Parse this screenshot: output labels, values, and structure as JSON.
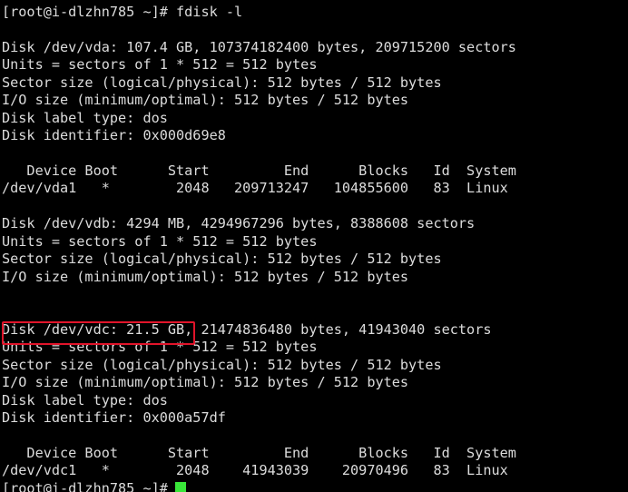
{
  "terminal": {
    "window_title": "root@i-dlzhn785:~",
    "background_color": "#000000",
    "foreground_color": "#dcdcdc",
    "cursor_color": "#39e639",
    "highlight_color": "#e1142a",
    "prompt": "[root@i-dlzhn785 ~]#",
    "command": "fdisk -l",
    "lines": [
      "[root@i-dlzhn785 ~]# fdisk -l",
      "",
      "Disk /dev/vda: 107.4 GB, 107374182400 bytes, 209715200 sectors",
      "Units = sectors of 1 * 512 = 512 bytes",
      "Sector size (logical/physical): 512 bytes / 512 bytes",
      "I/O size (minimum/optimal): 512 bytes / 512 bytes",
      "Disk label type: dos",
      "Disk identifier: 0x000d69e8",
      "",
      "   Device Boot      Start         End      Blocks   Id  System",
      "/dev/vda1   *        2048   209713247   104855600   83  Linux",
      "",
      "Disk /dev/vdb: 4294 MB, 4294967296 bytes, 8388608 sectors",
      "Units = sectors of 1 * 512 = 512 bytes",
      "Sector size (logical/physical): 512 bytes / 512 bytes",
      "I/O size (minimum/optimal): 512 bytes / 512 bytes",
      "",
      "",
      "Disk /dev/vdc: 21.5 GB, 21474836480 bytes, 41943040 sectors",
      "Units = sectors of 1 * 512 = 512 bytes",
      "Sector size (logical/physical): 512 bytes / 512 bytes",
      "I/O size (minimum/optimal): 512 bytes / 512 bytes",
      "Disk label type: dos",
      "Disk identifier: 0x000a57df",
      "",
      "   Device Boot      Start         End      Blocks   Id  System",
      "/dev/vdc1   *        2048    41943039    20970496   83  Linux"
    ],
    "partial_last_line": "[root@i-dlzhn785 ~]#",
    "highlighted_text": "Disk /dev/vdc: 21.5 GB",
    "disks": [
      {
        "device": "/dev/vda",
        "size": "107.4 GB",
        "bytes": "107374182400",
        "sectors": "209715200",
        "units": "sectors of 1 * 512 = 512 bytes",
        "sector_size": "512 bytes / 512 bytes",
        "io_size": "512 bytes / 512 bytes",
        "label_type": "dos",
        "identifier": "0x000d69e8",
        "partitions": [
          {
            "device": "/dev/vda1",
            "boot": "*",
            "start": "2048",
            "end": "209713247",
            "blocks": "104855600",
            "id": "83",
            "system": "Linux"
          }
        ]
      },
      {
        "device": "/dev/vdb",
        "size": "4294 MB",
        "bytes": "4294967296",
        "sectors": "8388608",
        "units": "sectors of 1 * 512 = 512 bytes",
        "sector_size": "512 bytes / 512 bytes",
        "io_size": "512 bytes / 512 bytes",
        "label_type": "",
        "identifier": "",
        "partitions": []
      },
      {
        "device": "/dev/vdc",
        "size": "21.5 GB",
        "bytes": "21474836480",
        "sectors": "41943040",
        "units": "sectors of 1 * 512 = 512 bytes",
        "sector_size": "512 bytes / 512 bytes",
        "io_size": "512 bytes / 512 bytes",
        "label_type": "dos",
        "identifier": "0x000a57df",
        "partitions": [
          {
            "device": "/dev/vdc1",
            "boot": "*",
            "start": "2048",
            "end": "41943039",
            "blocks": "20970496",
            "id": "83",
            "system": "Linux"
          }
        ]
      }
    ],
    "table_headers": [
      "Device",
      "Boot",
      "Start",
      "End",
      "Blocks",
      "Id",
      "System"
    ]
  }
}
